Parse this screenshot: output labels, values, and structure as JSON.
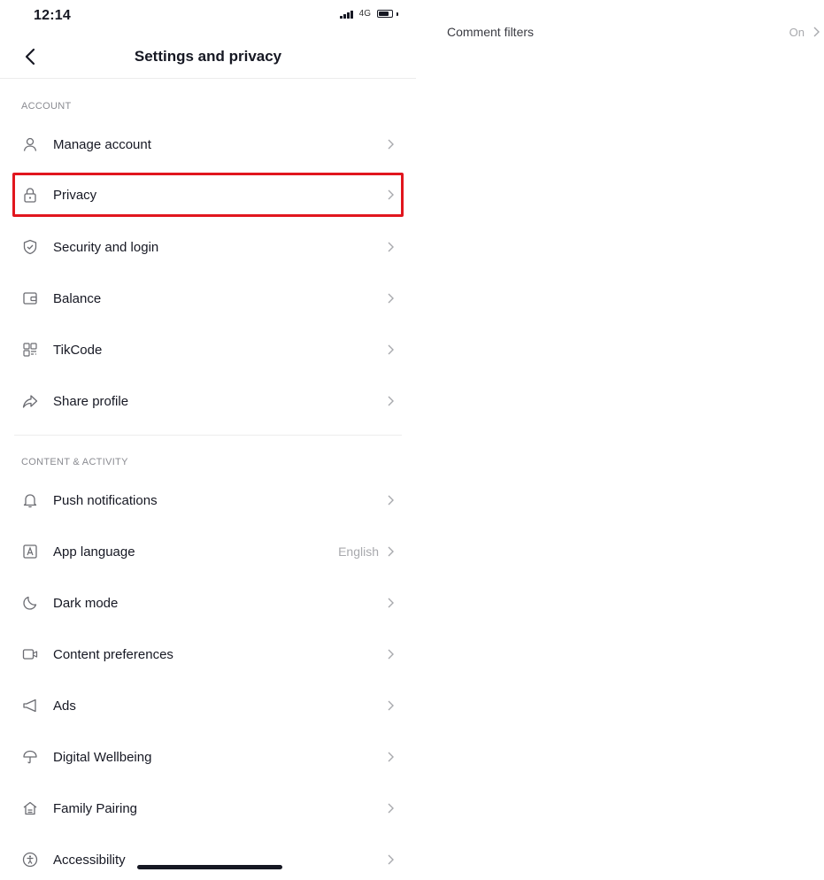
{
  "status_bar": {
    "time": "12:14",
    "network": "4G"
  },
  "header": {
    "title": "Settings and privacy"
  },
  "sections": {
    "account": {
      "title": "ACCOUNT",
      "items": [
        {
          "label": "Manage account",
          "icon": "person-icon"
        },
        {
          "label": "Privacy",
          "icon": "lock-icon",
          "highlighted": true
        },
        {
          "label": "Security and login",
          "icon": "shield-icon"
        },
        {
          "label": "Balance",
          "icon": "wallet-icon"
        },
        {
          "label": "TikCode",
          "icon": "qr-code-icon"
        },
        {
          "label": "Share profile",
          "icon": "share-icon"
        }
      ]
    },
    "content": {
      "title": "CONTENT & ACTIVITY",
      "items": [
        {
          "label": "Push notifications",
          "icon": "bell-icon"
        },
        {
          "label": "App language",
          "icon": "language-icon",
          "value": "English"
        },
        {
          "label": "Dark mode",
          "icon": "moon-icon"
        },
        {
          "label": "Content preferences",
          "icon": "video-icon"
        },
        {
          "label": "Ads",
          "icon": "megaphone-icon"
        },
        {
          "label": "Digital Wellbeing",
          "icon": "umbrella-icon"
        },
        {
          "label": "Family Pairing",
          "icon": "home-icon"
        },
        {
          "label": "Accessibility",
          "icon": "accessibility-icon"
        }
      ]
    }
  },
  "side_panel": {
    "label": "Comment filters",
    "value": "On"
  },
  "colors": {
    "highlight": "#e1161e",
    "text": "#161823",
    "muted": "#8a8b91"
  }
}
